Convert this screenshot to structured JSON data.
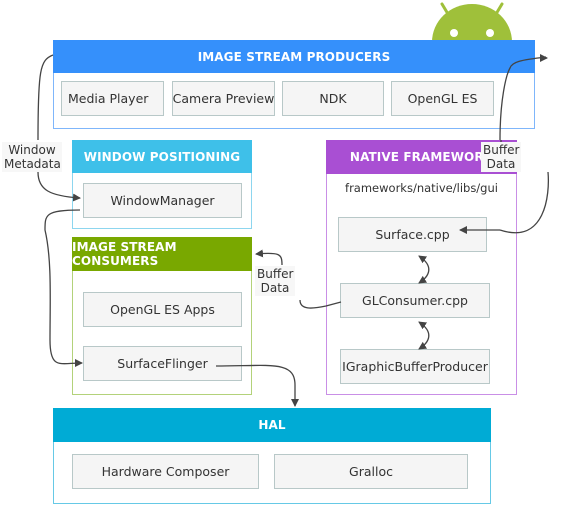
{
  "colors": {
    "producers": "#3590fb",
    "window_positioning": "#3ec0e9",
    "native_framework": "#a94fd3",
    "consumers": "#79a800",
    "hal": "#00abd5",
    "android": "#9fc03a"
  },
  "producers": {
    "title": "IMAGE STREAM PRODUCERS",
    "items": [
      "Media Player",
      "Camera Preview",
      "NDK",
      "OpenGL ES"
    ]
  },
  "window_positioning": {
    "title": "WINDOW POSITIONING",
    "items": [
      "WindowManager"
    ]
  },
  "native_framework": {
    "title": "NATIVE FRAMEWORK",
    "path": "frameworks/native/libs/gui",
    "items": [
      "Surface.cpp",
      "GLConsumer.cpp",
      "IGraphicBufferProducer"
    ]
  },
  "consumers": {
    "title": "IMAGE STREAM CONSUMERS",
    "items": [
      "OpenGL ES Apps",
      "SurfaceFlinger"
    ]
  },
  "hal": {
    "title": "HAL",
    "items": [
      "Hardware Composer",
      "Gralloc"
    ]
  },
  "labels": {
    "window_metadata": "Window Metadata",
    "buffer_data_right": "Buffer Data",
    "buffer_data_middle": "Buffer Data"
  },
  "logo": "android-robot"
}
